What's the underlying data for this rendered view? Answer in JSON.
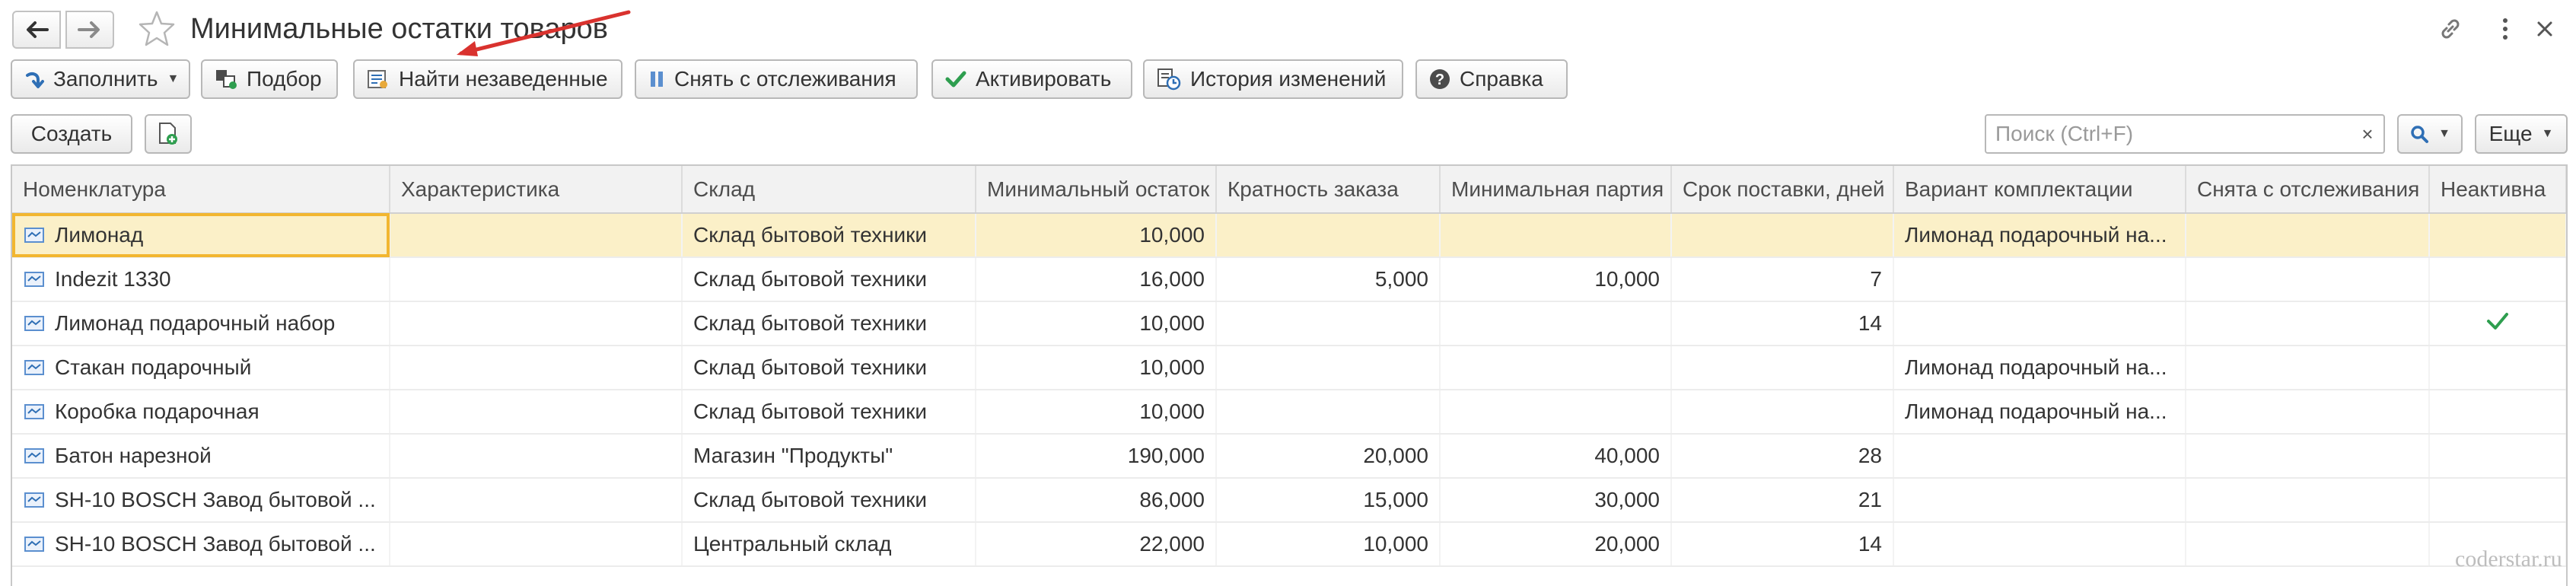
{
  "window": {
    "title": "Минимальные остатки товаров"
  },
  "toolbar": {
    "fill_label": "Заполнить",
    "pick_label": "Подбор",
    "find_label": "Найти незаведенные",
    "untrack_label": "Снять с отслеживания",
    "activate_label": "Активировать",
    "history_label": "История изменений",
    "help_label": "Справка"
  },
  "actions": {
    "create_label": "Создать",
    "search_placeholder": "Поиск (Ctrl+F)",
    "search_clear": "×",
    "more_label": "Еще"
  },
  "table": {
    "columns": [
      "Номенклатура",
      "Характеристика",
      "Склад",
      "Минимальный остаток",
      "Кратность заказа",
      "Минимальная партия",
      "Срок поставки, дней",
      "Вариант комплектации",
      "Снята с отслеживания",
      "Неактивна"
    ],
    "rows": [
      {
        "name": "Лимонад",
        "characteristic": "",
        "warehouse": "Склад бытовой техники",
        "min_stock": "10,000",
        "multiplicity": "",
        "min_batch": "",
        "lead_time": "",
        "kit_variant": "Лимонад подарочный на...",
        "untracked": "",
        "inactive": false,
        "selected": true
      },
      {
        "name": "Indezit 1330",
        "characteristic": "",
        "warehouse": "Склад бытовой техники",
        "min_stock": "16,000",
        "multiplicity": "5,000",
        "min_batch": "10,000",
        "lead_time": "7",
        "kit_variant": "",
        "untracked": "",
        "inactive": false,
        "selected": false
      },
      {
        "name": "Лимонад подарочный набор",
        "characteristic": "",
        "warehouse": "Склад бытовой техники",
        "min_stock": "10,000",
        "multiplicity": "",
        "min_batch": "",
        "lead_time": "14",
        "kit_variant": "",
        "untracked": "",
        "inactive": true,
        "selected": false
      },
      {
        "name": "Стакан подарочный",
        "characteristic": "",
        "warehouse": "Склад бытовой техники",
        "min_stock": "10,000",
        "multiplicity": "",
        "min_batch": "",
        "lead_time": "",
        "kit_variant": "Лимонад подарочный на...",
        "untracked": "",
        "inactive": false,
        "selected": false
      },
      {
        "name": "Коробка подарочная",
        "characteristic": "",
        "warehouse": "Склад бытовой техники",
        "min_stock": "10,000",
        "multiplicity": "",
        "min_batch": "",
        "lead_time": "",
        "kit_variant": "Лимонад подарочный на...",
        "untracked": "",
        "inactive": false,
        "selected": false
      },
      {
        "name": "Батон нарезной",
        "characteristic": "",
        "warehouse": "Магазин \"Продукты\"",
        "min_stock": "190,000",
        "multiplicity": "20,000",
        "min_batch": "40,000",
        "lead_time": "28",
        "kit_variant": "",
        "untracked": "",
        "inactive": false,
        "selected": false
      },
      {
        "name": "SH-10 BOSCH Завод бытовой ...",
        "characteristic": "",
        "warehouse": "Склад бытовой техники",
        "min_stock": "86,000",
        "multiplicity": "15,000",
        "min_batch": "30,000",
        "lead_time": "21",
        "kit_variant": "",
        "untracked": "",
        "inactive": false,
        "selected": false
      },
      {
        "name": "SH-10 BOSCH Завод бытовой ...",
        "characteristic": "",
        "warehouse": "Центральный склад",
        "min_stock": "22,000",
        "multiplicity": "10,000",
        "min_batch": "20,000",
        "lead_time": "14",
        "kit_variant": "",
        "untracked": "",
        "inactive": false,
        "selected": false
      }
    ]
  },
  "watermark": "coderstar.ru",
  "colors": {
    "selected_row": "#fbf0c8",
    "focus_outline": "#f2b630",
    "check_green": "#2e9e4f",
    "accent_blue": "#2f6fb5",
    "annotation_red": "#d9322e"
  },
  "icons": {
    "back": "arrow-left-icon",
    "forward": "arrow-right-icon",
    "favorite": "star-icon",
    "link": "link-icon",
    "menu": "vertical-dots-icon",
    "close": "close-icon",
    "fill": "fill-arrow-icon",
    "pick": "pick-icon",
    "find": "find-unregistered-icon",
    "untrack": "pause-icon",
    "activate": "checkmark-icon",
    "history": "history-icon",
    "help": "question-icon",
    "add": "add-document-icon",
    "search": "magnifier-icon",
    "row": "catalog-item-icon",
    "inactive": "checkmark-icon"
  }
}
